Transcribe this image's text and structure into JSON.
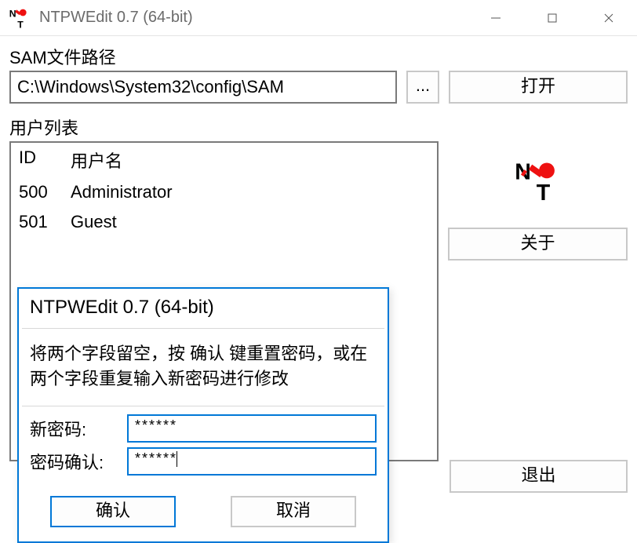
{
  "window": {
    "title": "NTPWEdit 0.7 (64-bit)"
  },
  "sam_path": {
    "label": "SAM文件路径",
    "value": "C:\\Windows\\System32\\config\\SAM",
    "browse_label": "...",
    "open_label": "打开"
  },
  "userlist": {
    "label": "用户列表",
    "col_id": "ID",
    "col_name": "用户名",
    "rows": [
      {
        "id": "500",
        "name": "Administrator"
      },
      {
        "id": "501",
        "name": "Guest"
      }
    ]
  },
  "sidebar": {
    "about_label": "关于",
    "exit_label": "退出"
  },
  "dialog": {
    "title": "NTPWEdit 0.7 (64-bit)",
    "message": "将两个字段留空，按 确认 键重置密码，或在两个字段重复输入新密码进行修改",
    "new_password_label": "新密码:",
    "confirm_password_label": "密码确认:",
    "new_password_value": "******",
    "confirm_password_value": "******",
    "ok_label": "确认",
    "cancel_label": "取消"
  }
}
